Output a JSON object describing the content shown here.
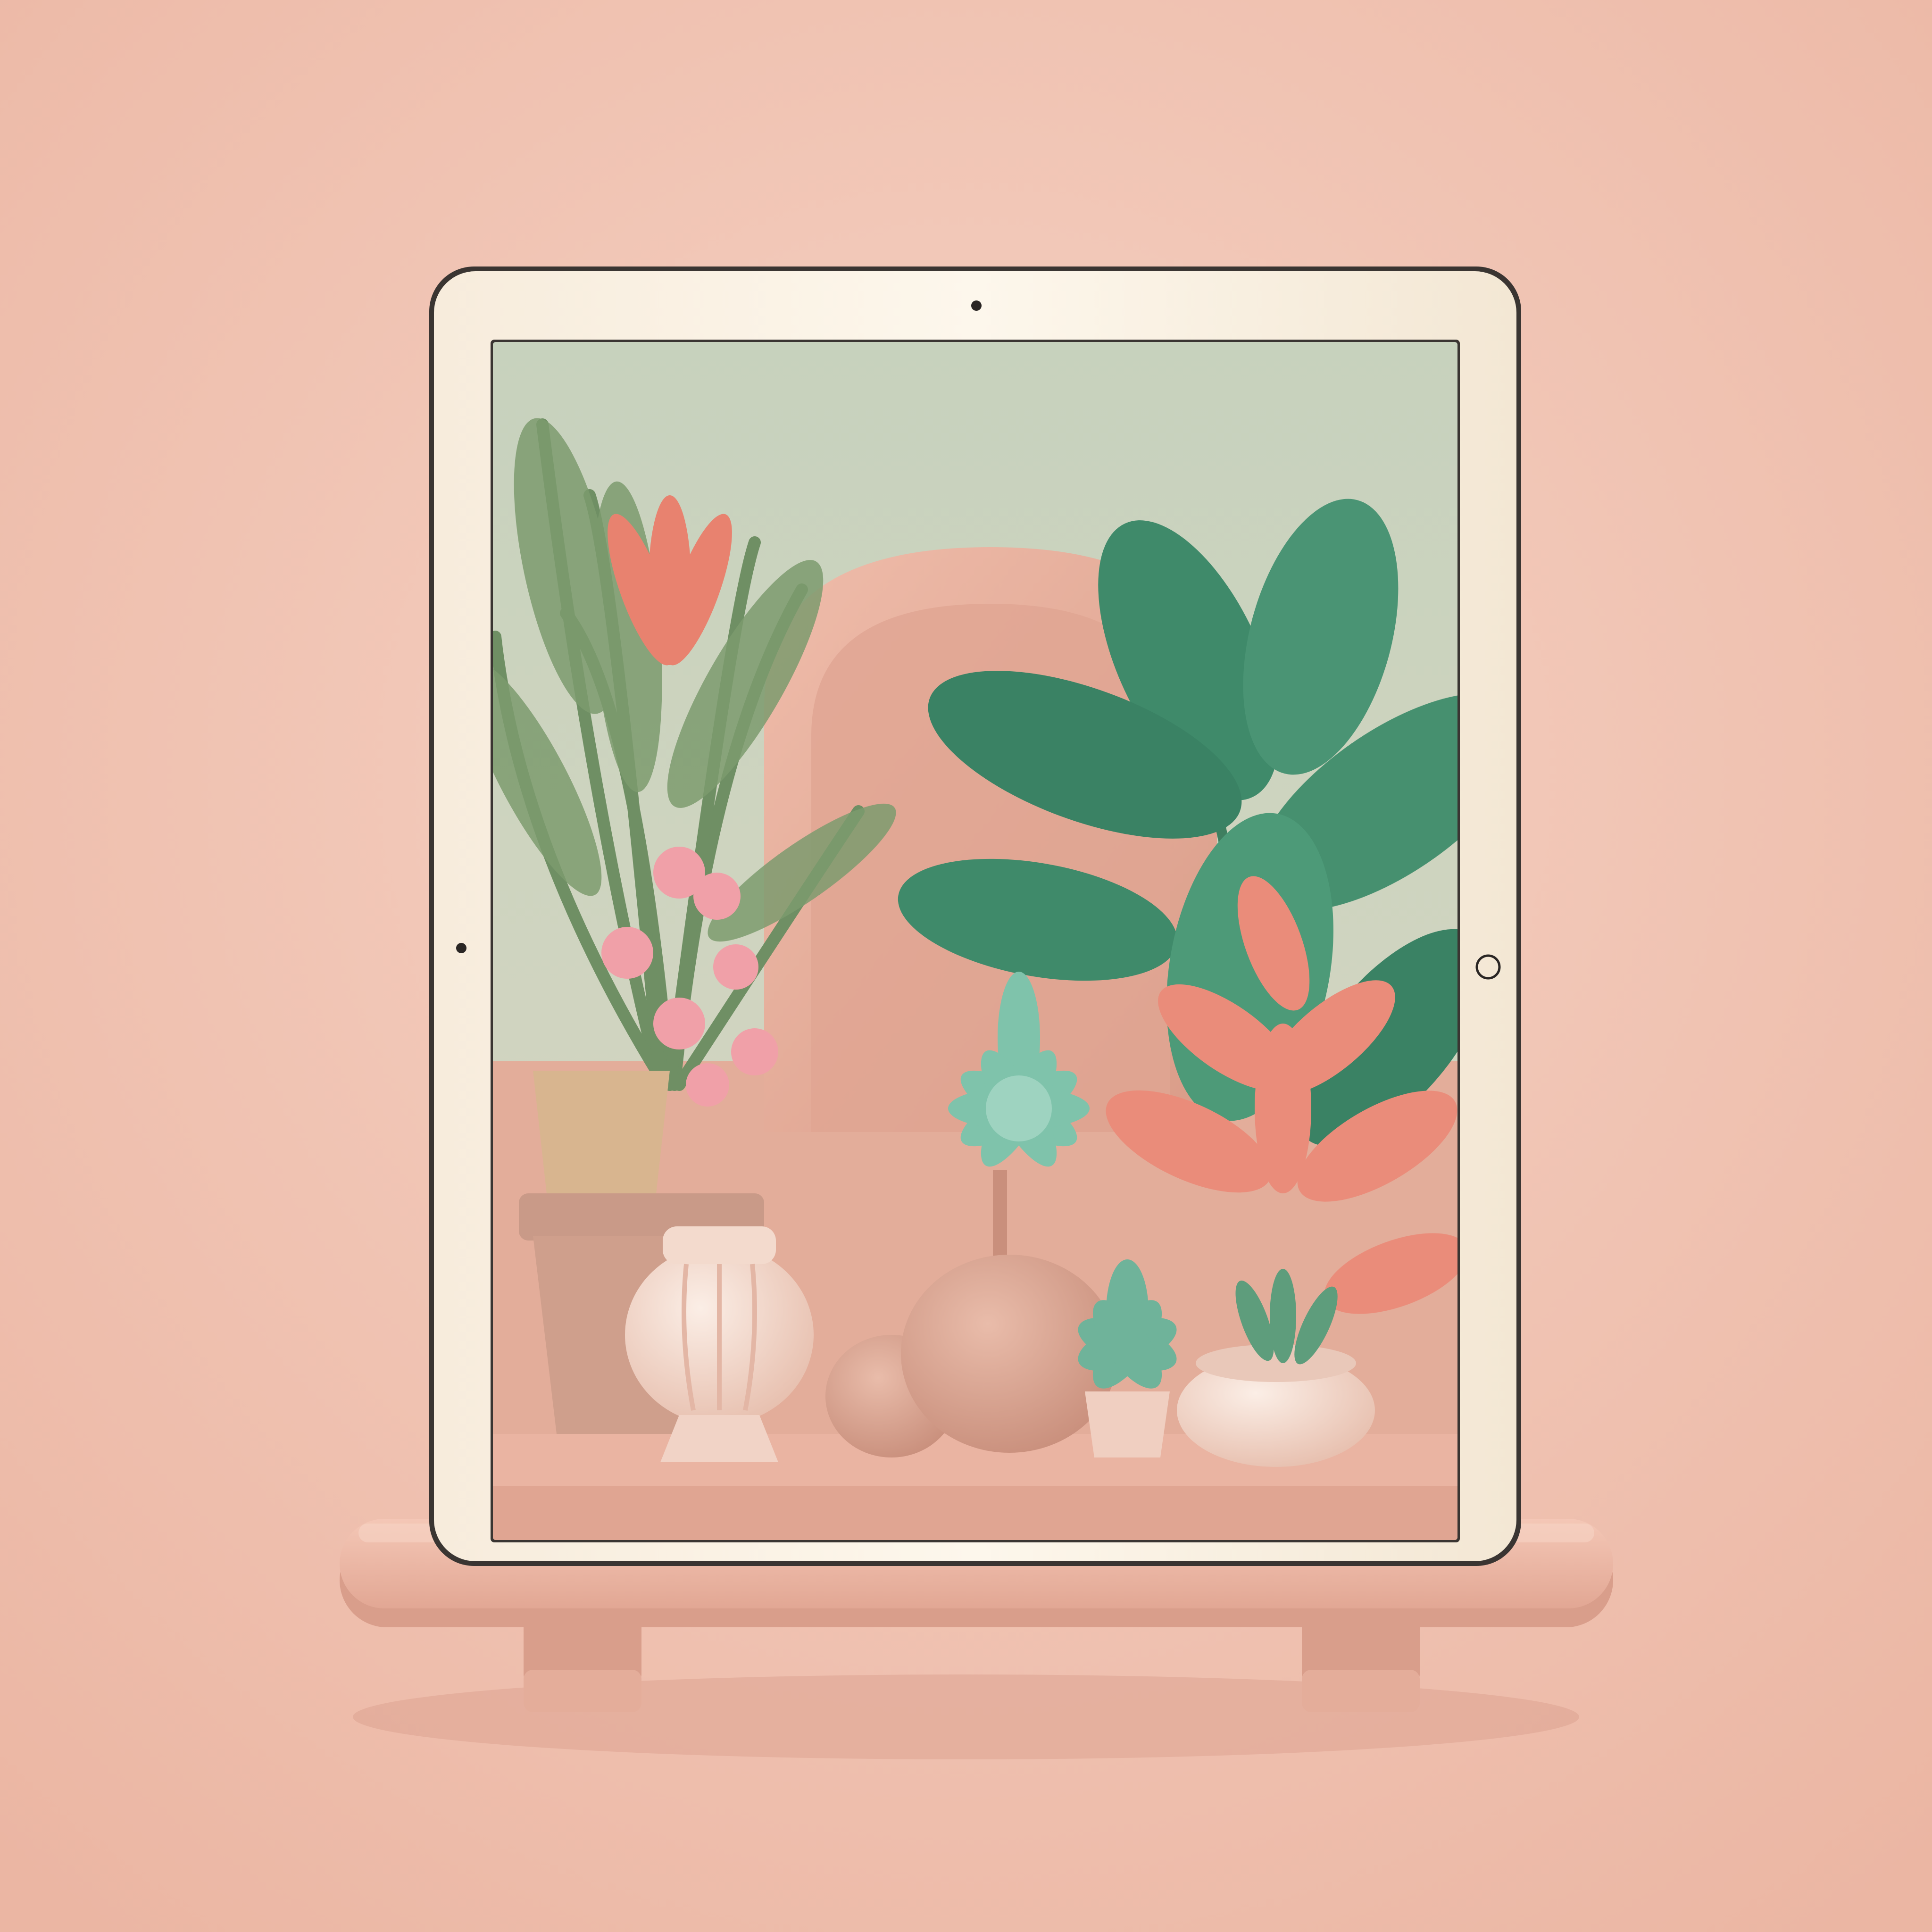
{
  "scene": {
    "kind": "3d-render-mockup",
    "subject": "tablet-on-stand",
    "screen_content": "potted-plants-arrangement",
    "text_present": false
  },
  "colors": {
    "background": "#f2c4b3",
    "background_light": "#f6d2c4",
    "stand": "#efbba8",
    "stand_shadow": "#d99e8b",
    "bezel": "#fbf3e6",
    "bezel_edge": "#3a3532",
    "screen_sky": "#cbd5bf",
    "arch": "#e6ab98",
    "shelf": "#eab4a2",
    "palm_green": "#6f8f64",
    "leaf_green": "#3f8a6a",
    "succulent": "#7fc3ab",
    "pink_flower": "#f0a0a8",
    "coral_leaf": "#ea8c7a",
    "pot_cream": "#f4d9cc",
    "stone": "#d9a694"
  },
  "icons": {
    "front_camera": "camera-dot-icon",
    "side_dot": "side-sensor-icon",
    "home_button": "home-button-icon"
  }
}
